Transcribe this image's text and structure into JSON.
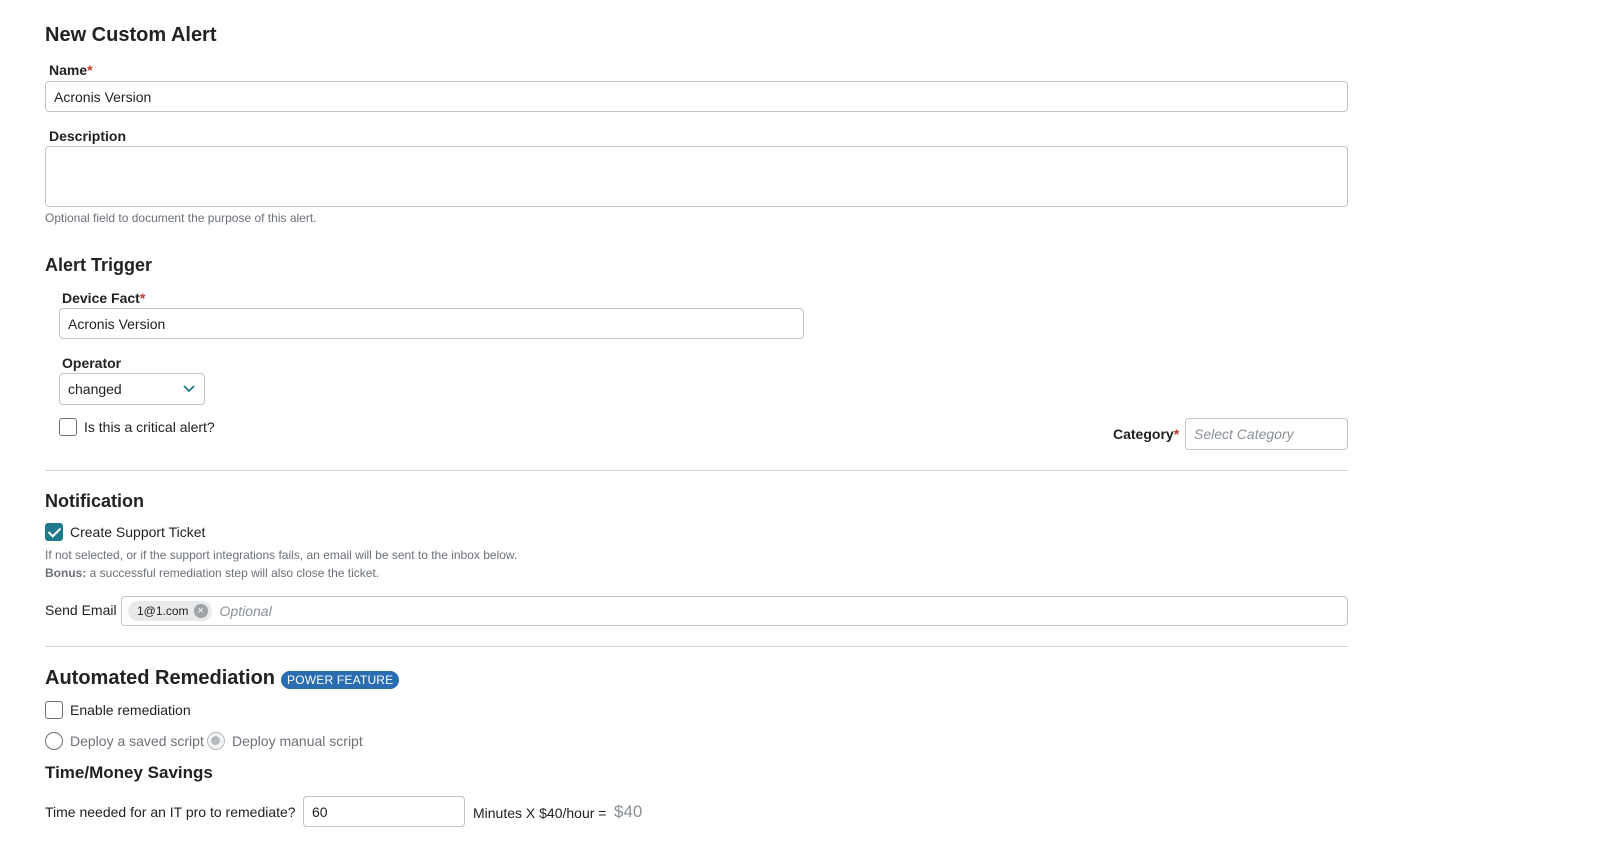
{
  "page": {
    "title": "New Custom Alert"
  },
  "name_field": {
    "label": "Name",
    "required_mark": "*",
    "value": "Acronis Version"
  },
  "description_field": {
    "label": "Description",
    "value": "",
    "help": "Optional field to document the purpose of this alert."
  },
  "alert_trigger": {
    "heading": "Alert Trigger",
    "device_fact": {
      "label": "Device Fact",
      "required_mark": "*",
      "value": "Acronis Version"
    },
    "operator": {
      "label": "Operator",
      "value": "changed"
    },
    "critical_checkbox": {
      "label": "Is this a critical alert?",
      "checked": false
    },
    "category": {
      "label": "Category",
      "required_mark": "*",
      "placeholder": "Select Category"
    }
  },
  "notification": {
    "heading": "Notification",
    "support_ticket": {
      "label": "Create Support Ticket",
      "checked": true
    },
    "help_line1": "If not selected, or if the support integrations fails, an email will be sent to the inbox below.",
    "bonus_label": "Bonus:",
    "bonus_text": " a successful remediation step will also close the ticket.",
    "send_email": {
      "label": "Send Email",
      "chips": [
        "1@1.com"
      ],
      "placeholder": "Optional"
    }
  },
  "remediation": {
    "heading": "Automated Remediation",
    "badge": "POWER FEATURE",
    "enable": {
      "label": "Enable remediation",
      "checked": false
    },
    "options": [
      {
        "label": "Deploy a saved script",
        "selected": false
      },
      {
        "label": "Deploy manual script",
        "selected": true
      }
    ]
  },
  "savings": {
    "heading": "Time/Money Savings",
    "question": "Time needed for an IT pro to remediate?",
    "minutes_value": "60",
    "rate_text": "Minutes X $40/hour =",
    "total": "$40"
  },
  "colors": {
    "accent": "#1f7a8c",
    "badge": "#2a6db0",
    "required": "#c0392b"
  }
}
